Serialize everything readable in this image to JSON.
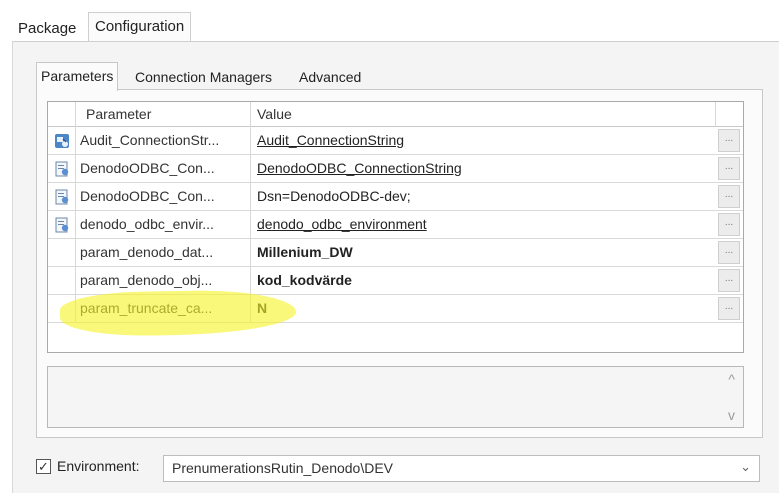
{
  "outer_tabs": [
    {
      "label": "Package"
    },
    {
      "label": "Configuration"
    }
  ],
  "inner_tabs": [
    {
      "label": "Parameters"
    },
    {
      "label": "Connection Managers"
    },
    {
      "label": "Advanced"
    }
  ],
  "grid": {
    "header": {
      "parameter": "Parameter",
      "value": "Value"
    },
    "rows": [
      {
        "icon": "connection-parameter-icon",
        "parameter": "Audit_ConnectionStr...",
        "value": "Audit_ConnectionString",
        "style": "link",
        "button": "..."
      },
      {
        "icon": "connection-parameter-icon",
        "parameter": "DenodoODBC_Con...",
        "value": "DenodoODBC_ConnectionString",
        "style": "link",
        "button": "..."
      },
      {
        "icon": "connection-parameter-icon",
        "parameter": "DenodoODBC_Con...",
        "value": "Dsn=DenodoODBC-dev;",
        "style": "plain",
        "button": "..."
      },
      {
        "icon": "connection-parameter-icon",
        "parameter": "denodo_odbc_envir...",
        "value": "denodo_odbc_environment",
        "style": "link",
        "button": "..."
      },
      {
        "icon": "",
        "parameter": "param_denodo_dat...",
        "value": "Millenium_DW",
        "style": "bold",
        "button": "..."
      },
      {
        "icon": "",
        "parameter": "param_denodo_obj...",
        "value": "kod_kodvärde",
        "style": "bold",
        "button": "..."
      },
      {
        "icon": "",
        "parameter": "param_truncate_ca...",
        "value": "N",
        "style": "bold",
        "button": "..."
      }
    ]
  },
  "description": {
    "scroll_up": "^",
    "scroll_down": "v"
  },
  "environment": {
    "checked": true,
    "check_mark": "✓",
    "label": "Environment:",
    "value": "PrenumerationsRutin_Denodo\\DEV",
    "chevron": "⌄"
  },
  "colors": {
    "highlight": "#f6f328"
  }
}
